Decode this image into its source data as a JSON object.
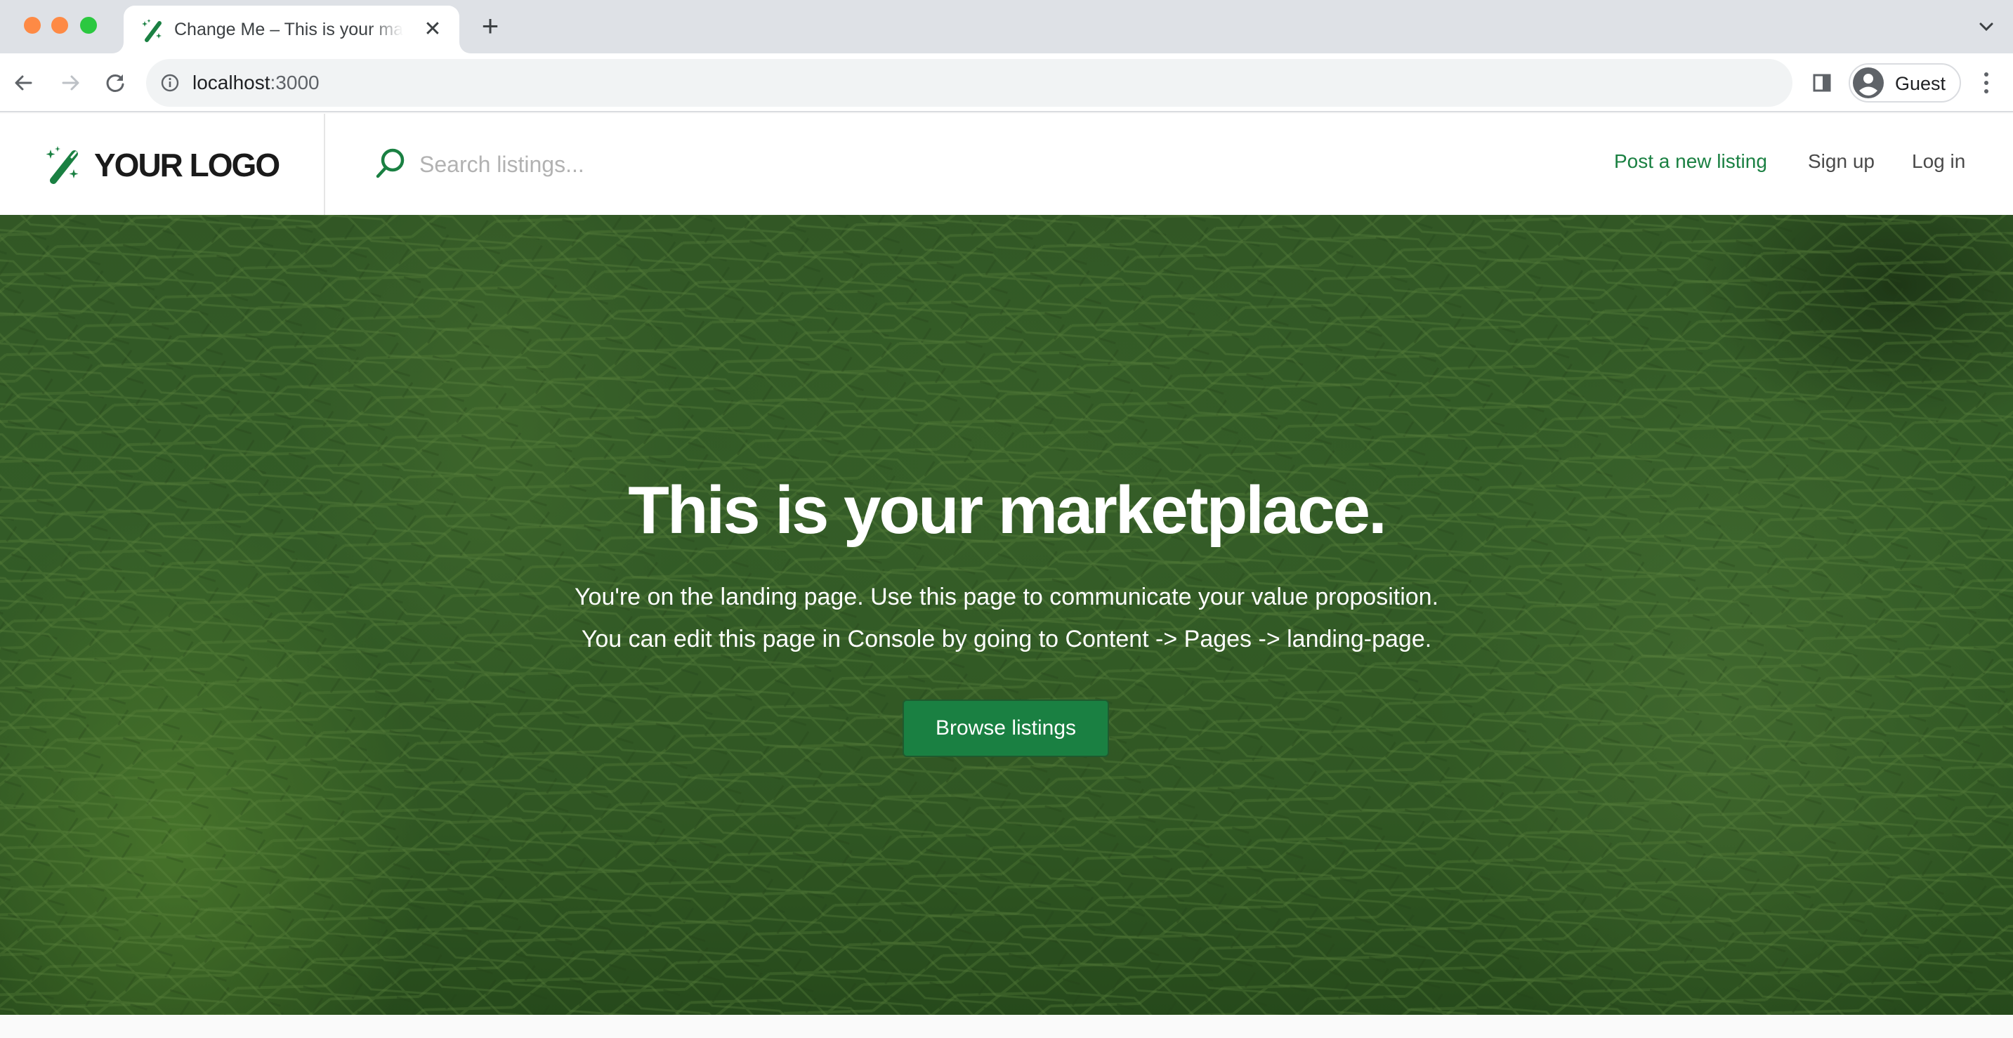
{
  "browser": {
    "tab": {
      "title": "Change Me – This is your marketplace.",
      "favicon": "magic-wand-icon",
      "close_icon": "close-icon"
    },
    "new_tab_icon": "plus-icon",
    "tab_search_icon": "chevron-down-icon",
    "toolbar": {
      "back_icon": "arrow-left-icon",
      "forward_icon": "arrow-right-icon",
      "reload_icon": "reload-icon",
      "site_info_icon": "info-icon",
      "url_host": "localhost",
      "url_port": ":3000",
      "side_panel_icon": "side-panel-icon",
      "profile_label": "Guest",
      "profile_icon": "person-icon",
      "menu_icon": "kebab-menu-icon"
    }
  },
  "header": {
    "logo_text": "YOUR LOGO",
    "logo_icon": "magic-wand-icon",
    "search": {
      "icon": "search-icon",
      "value": "",
      "placeholder": "Search listings..."
    },
    "nav": [
      {
        "label": "Post a new listing"
      },
      {
        "label": "Sign up"
      },
      {
        "label": "Log in"
      }
    ]
  },
  "hero": {
    "title": "This is your marketplace.",
    "subtitle_lines": [
      "You're on the landing page. Use this page to communicate your value proposition.",
      "You can edit this page in Console by going to Content -> Pages -> landing-page."
    ],
    "cta_label": "Browse listings"
  },
  "colors": {
    "brand_green": "#1a8042",
    "tab_strip": "#dee1e6",
    "omnibox": "#f1f3f4",
    "nav_text": "#4a4a4a",
    "placeholder": "#b2b2b2"
  }
}
